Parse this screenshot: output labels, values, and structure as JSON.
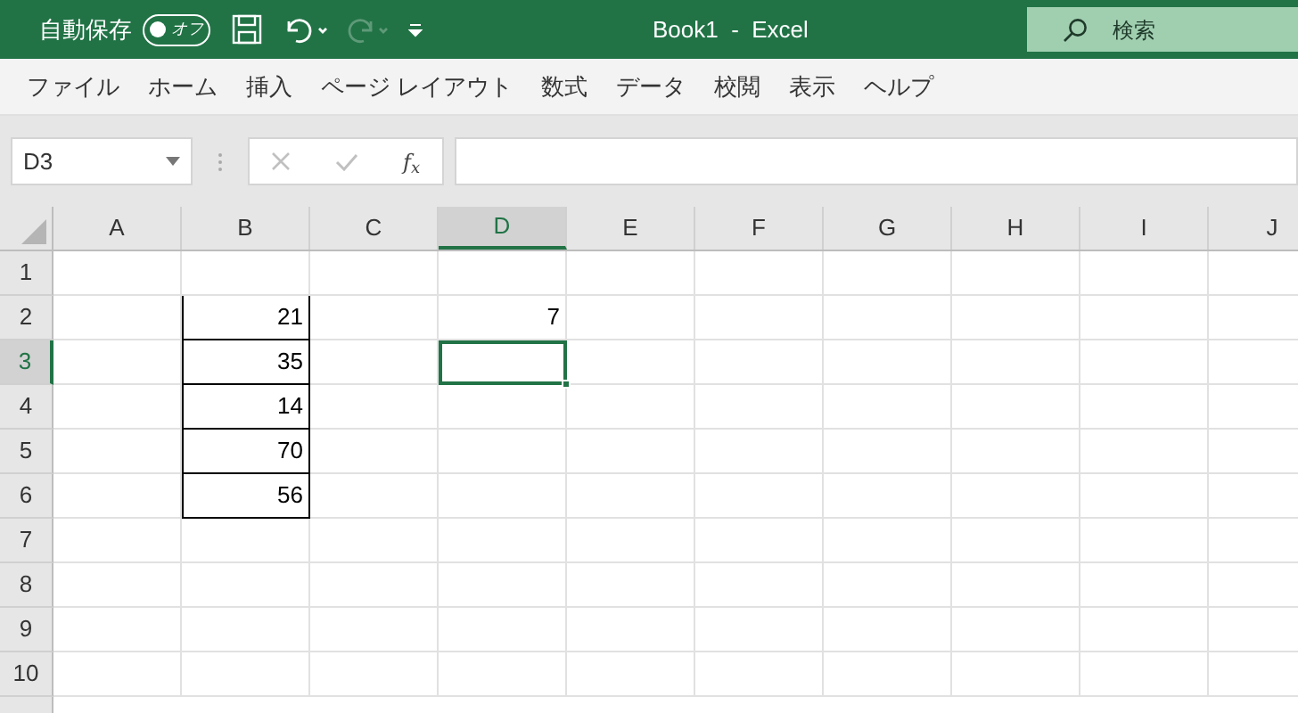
{
  "title_bar": {
    "autosave_label": "自動保存",
    "autosave": {
      "on": false,
      "label": "オフ"
    },
    "undo": {
      "disabled": false
    },
    "redo": {
      "disabled": true
    },
    "title": "Book1  -  Excel",
    "search": {
      "placeholder": "検索"
    }
  },
  "ribbon_tabs": [
    {
      "label": "ファイル",
      "selected": false
    },
    {
      "label": "ホーム",
      "selected": false
    },
    {
      "label": "挿入",
      "selected": false
    },
    {
      "label": "ページ レイアウト",
      "selected": false
    },
    {
      "label": "数式",
      "selected": false
    },
    {
      "label": "データ",
      "selected": false
    },
    {
      "label": "校閲",
      "selected": false
    },
    {
      "label": "表示",
      "selected": false
    },
    {
      "label": "ヘルプ",
      "selected": false
    }
  ],
  "formula_bar": {
    "name_box": "D3",
    "fx": "f$_{x}$"
  },
  "sheet": {
    "columns": [
      {
        "label": "A",
        "selected": false
      },
      {
        "label": "B",
        "selected": false
      },
      {
        "label": "C",
        "selected": false
      },
      {
        "label": "D",
        "selected": true
      },
      {
        "label": "E",
        "selected": false
      },
      {
        "label": "F",
        "selected": false
      },
      {
        "label": "G",
        "selected": false
      },
      {
        "label": "H",
        "selected": false
      },
      {
        "label": "I",
        "selected": false
      },
      {
        "label": "J",
        "selected": false
      }
    ],
    "rows": [
      {
        "label": "1",
        "selected": false
      },
      {
        "label": "2",
        "selected": false,
        "cells": [
          {
            "bordered": false,
            "selected": false
          },
          {
            "value": "21",
            "bordered": true,
            "selected": false
          },
          {
            "bordered": false,
            "selected": false
          },
          {
            "value": "7",
            "bordered": false,
            "selected": false
          }
        ]
      },
      {
        "label": "3",
        "selected": true,
        "cells": [
          {
            "bordered": false,
            "selected": false
          },
          {
            "value": "35",
            "bordered": true,
            "selected": false
          },
          {
            "bordered": false,
            "selected": false
          },
          {
            "bordered": false,
            "selected": true
          }
        ]
      },
      {
        "label": "4",
        "selected": false,
        "cells": [
          {
            "bordered": false,
            "selected": false
          },
          {
            "value": "14",
            "bordered": true,
            "selected": false
          }
        ]
      },
      {
        "label": "5",
        "selected": false,
        "cells": [
          {
            "bordered": false,
            "selected": false
          },
          {
            "value": "70",
            "bordered": true,
            "selected": false
          }
        ]
      },
      {
        "label": "6",
        "selected": false,
        "cells": [
          {
            "bordered": false,
            "selected": false
          },
          {
            "value": "56",
            "bordered": true,
            "selected": false
          }
        ]
      },
      {
        "label": "7",
        "selected": false
      },
      {
        "label": "8",
        "selected": false
      },
      {
        "label": "9",
        "selected": false
      },
      {
        "label": "10",
        "selected": false
      }
    ]
  }
}
